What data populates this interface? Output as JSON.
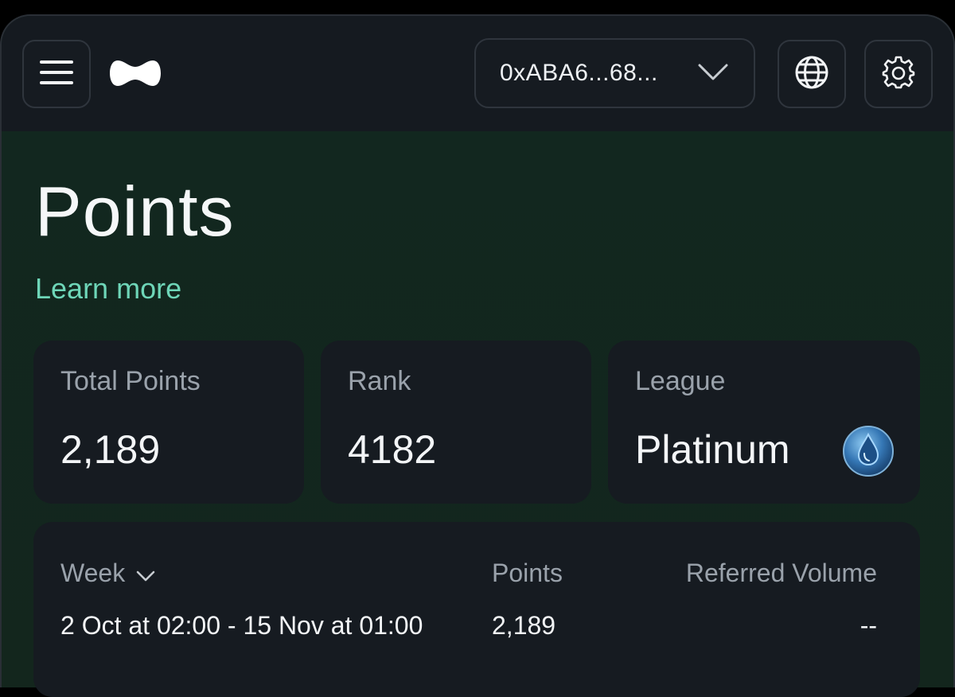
{
  "header": {
    "wallet_address": "0xABA6...68...",
    "icons": {
      "menu": "menu-icon",
      "logo": "app-logo",
      "wallet_chevron": "chevron-down-icon",
      "globe": "globe-icon",
      "settings": "gear-icon"
    }
  },
  "page": {
    "title": "Points",
    "learn_more": "Learn more"
  },
  "stats": {
    "total_points": {
      "label": "Total Points",
      "value": "2,189"
    },
    "rank": {
      "label": "Rank",
      "value": "4182"
    },
    "league": {
      "label": "League",
      "value": "Platinum",
      "badge_icon": "water-drop-icon"
    }
  },
  "table": {
    "columns": {
      "week": "Week",
      "points": "Points",
      "referred_volume": "Referred Volume"
    },
    "rows": [
      {
        "week": "2 Oct at 02:00 - 15 Nov at 01:00",
        "points": "2,189",
        "referred_volume": "--"
      }
    ]
  },
  "colors": {
    "accent": "#6ed6b8",
    "background": "#12271f",
    "card": "#161b21",
    "header": "#151a20"
  }
}
